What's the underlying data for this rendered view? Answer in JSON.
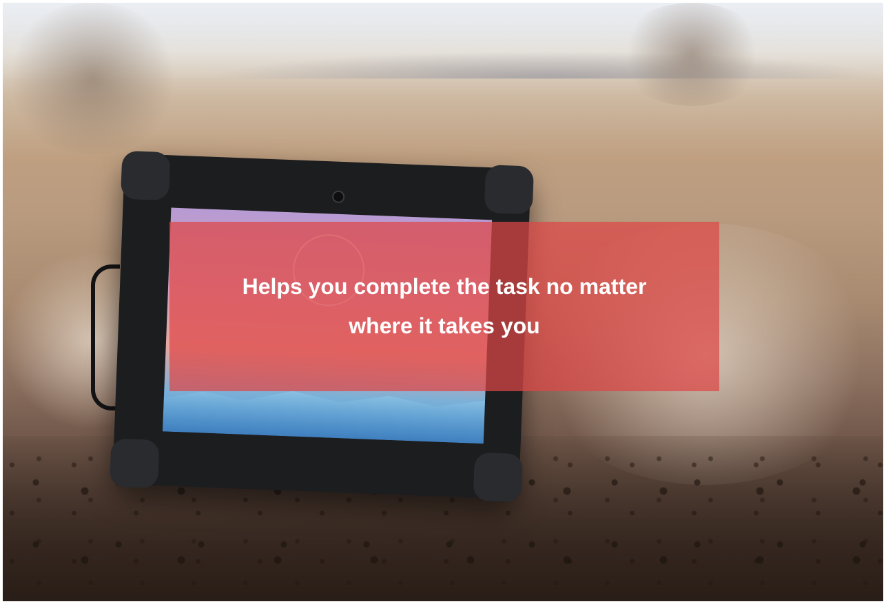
{
  "overlay": {
    "headline": "Helps you complete the task no matter where it takes you",
    "background_color": "#de4646",
    "text_color": "#ffffff"
  },
  "photo": {
    "subject_icon": "rugged-tablet-icon"
  }
}
